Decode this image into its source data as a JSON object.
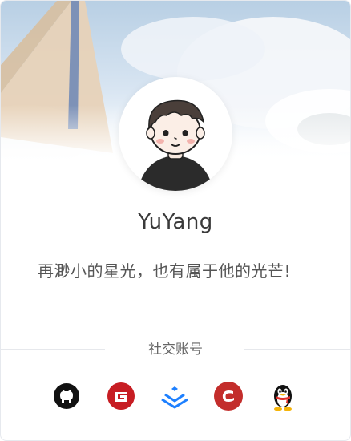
{
  "profile": {
    "name": "YuYang",
    "motto": "再渺小的星光，也有属于他的光芒!"
  },
  "social": {
    "title": "社交账号",
    "links": [
      {
        "icon": "github-icon"
      },
      {
        "icon": "gitee-icon"
      },
      {
        "icon": "juejin-icon"
      },
      {
        "icon": "csdn-icon"
      },
      {
        "icon": "qq-penguin-icon"
      }
    ]
  },
  "colors": {
    "name_text": "#3a3a3a",
    "motto_text": "#555555",
    "gitee": "#c71d23",
    "csdn": "#c32d2b",
    "juejin": "#1e80ff",
    "github": "#111111"
  }
}
